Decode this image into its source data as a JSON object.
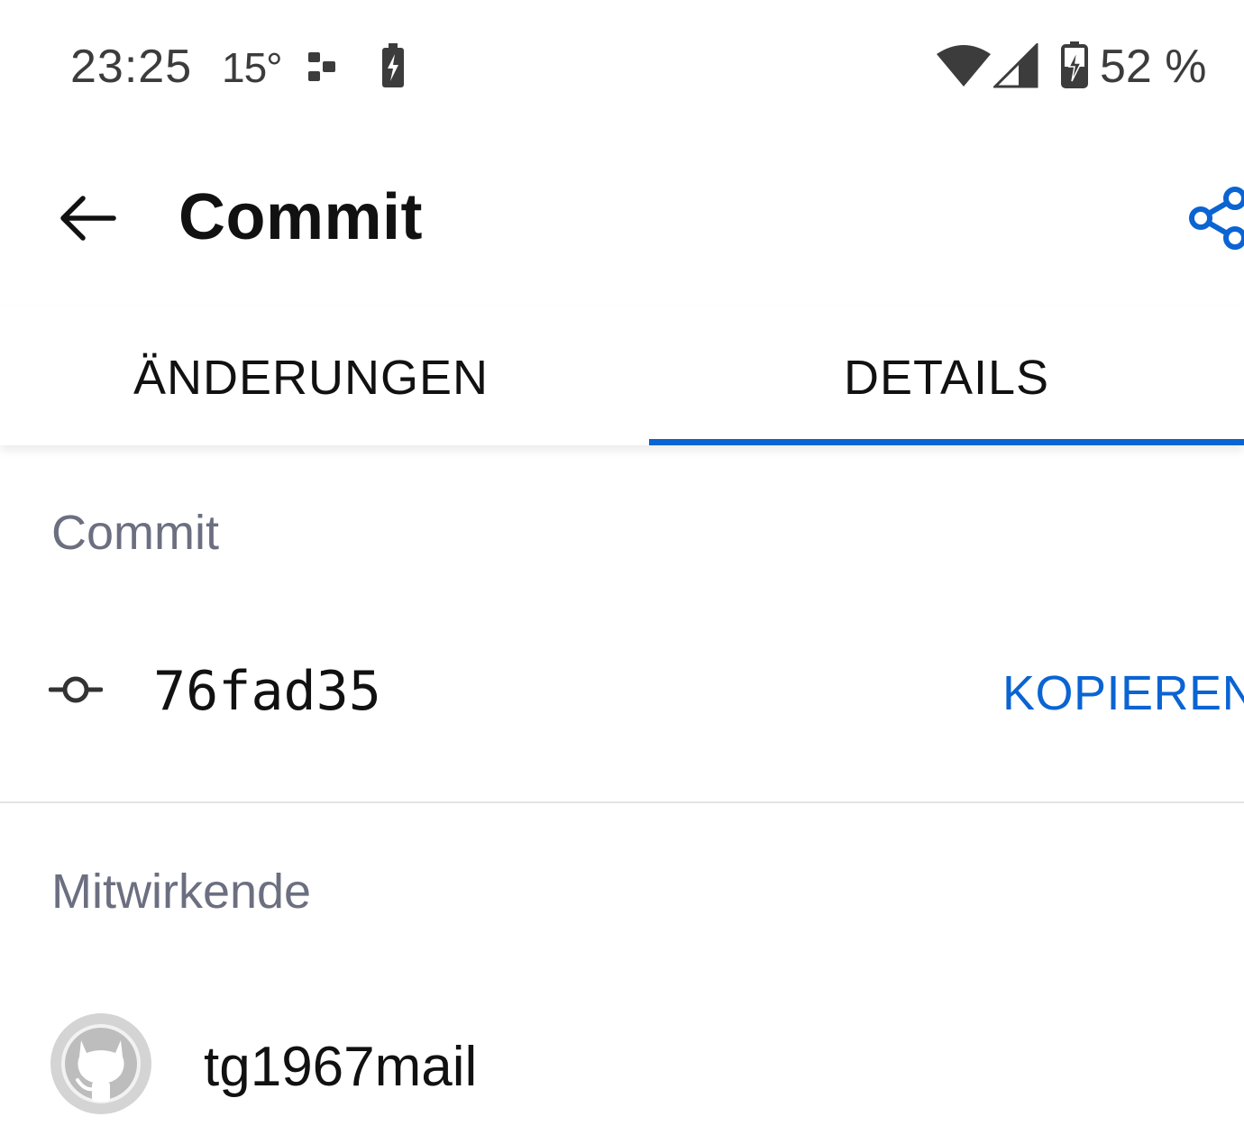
{
  "status_bar": {
    "time": "23:25",
    "temperature": "15°",
    "battery_percent": "52 %",
    "icons": [
      "navigation-icon",
      "battery-charging-small-icon",
      "wifi-icon",
      "cell-signal-icon",
      "battery-charging-icon"
    ]
  },
  "app_bar": {
    "title": "Commit",
    "back_icon": "arrow-left-icon",
    "share_icon": "share-icon"
  },
  "tabs": [
    {
      "label": "ÄNDERUNGEN",
      "selected": false
    },
    {
      "label": "DETAILS",
      "selected": true
    }
  ],
  "commit_section": {
    "label": "Commit",
    "hash": "76fad35",
    "copy_label": "KOPIEREN",
    "icon": "git-commit-icon"
  },
  "contributors_section": {
    "label": "Mitwirkende",
    "items": [
      {
        "name": "tg1967mail",
        "avatar": "github-octocat-avatar"
      }
    ]
  },
  "colors": {
    "accent": "#0a64d2",
    "section_label": "#6b6f80",
    "text": "#111111"
  }
}
